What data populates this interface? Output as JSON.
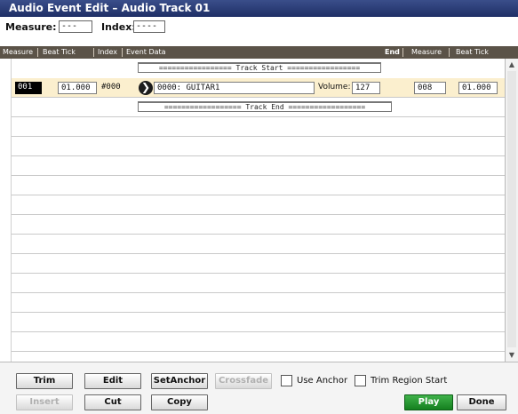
{
  "window": {
    "title": "Audio Event Edit – Audio Track 01"
  },
  "header": {
    "measure_label": "Measure:",
    "measure_value": "---",
    "index_label": "Index:",
    "index_value": "----"
  },
  "columns": {
    "measure": "Measure",
    "beat_tick": "Beat Tick",
    "index": "Index",
    "event_data": "Event Data",
    "end": "End",
    "end_measure": "Measure",
    "end_beat_tick": "Beat Tick"
  },
  "rows": {
    "track_start": "================= Track Start =================",
    "event": {
      "measure": "001",
      "beat_tick": "01.000",
      "index": "#000",
      "event_data": "0000: GUITAR1",
      "volume_label": "Volume:",
      "volume_value": "127",
      "end_measure": "008",
      "end_beat_tick": "01.000",
      "arrow_glyph": "❯"
    },
    "track_end": "================== Track End =================="
  },
  "buttons": {
    "trim": "Trim",
    "edit": "Edit",
    "set_anchor": "SetAnchor",
    "crossfade": "Crossfade",
    "use_anchor": "Use Anchor",
    "trim_region_start": "Trim Region Start",
    "insert": "Insert",
    "cut": "Cut",
    "copy": "Copy",
    "play": "Play",
    "done": "Done"
  },
  "scroll": {
    "up_glyph": "▲",
    "down_glyph": "▼"
  },
  "colors": {
    "title_bar": "#2a3c78",
    "column_header": "#5b5348",
    "selected_row": "#fbefce",
    "play_button": "#1f9a2b"
  }
}
